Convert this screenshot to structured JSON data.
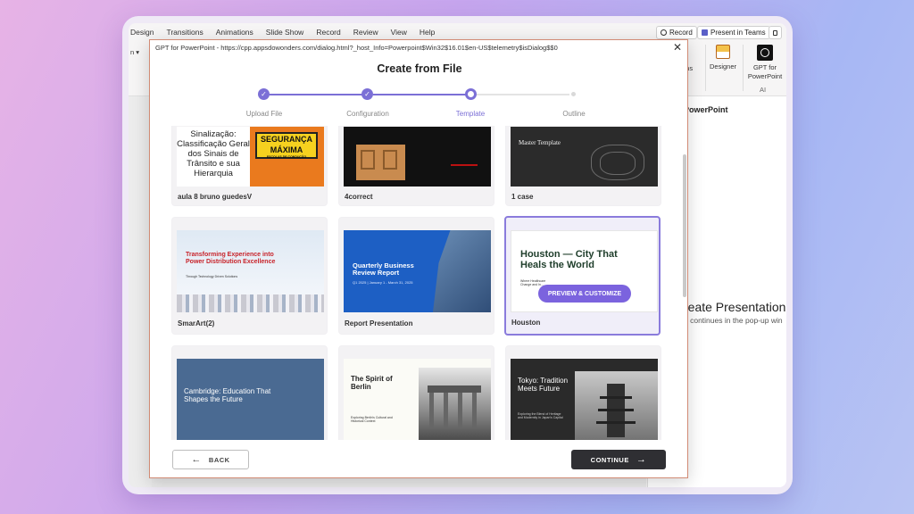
{
  "ribbon": {
    "menu": [
      "Design",
      "Transitions",
      "Animations",
      "Slide Show",
      "Record",
      "Review",
      "View",
      "Help"
    ],
    "record_label": "Record",
    "present_label": "Present in Teams",
    "addins_label": "-ins",
    "designer_label": "Designer",
    "gpt_label": "GPT for PowerPoint",
    "ai_group_label": "AI",
    "left_label": "n"
  },
  "side_pane": {
    "title": "PowerPoint",
    "heading": "reate Presentation",
    "subtext": "n continues in the pop-up win"
  },
  "dialog": {
    "url": "GPT for PowerPoint - https://cpp.appsdowonders.com/dialog.html?_host_Info=Powerpoint$Win32$16.01$en-US$telemetry$isDialog$$0",
    "title": "Create from File",
    "steps": [
      {
        "label": "Upload File",
        "state": "done"
      },
      {
        "label": "Configuration",
        "state": "done"
      },
      {
        "label": "Template",
        "state": "active"
      },
      {
        "label": "Outline",
        "state": "todo"
      }
    ],
    "back_label": "BACK",
    "continue_label": "CONTINUE"
  },
  "templates": [
    {
      "name": "aula 8 bruno guedesV",
      "thumb_text": "Sinalização: Classificação Geral dos Sinais de Trânsito e sua Hierarquia",
      "badge": "SEGURANÇA MÁXIMA",
      "badge_sub": "ESCOLAS DE CONDUÇÃO"
    },
    {
      "name": "4correct"
    },
    {
      "name": "1 case",
      "thumb_text": "Master Template"
    },
    {
      "name": "SmarArt(2)",
      "thumb_text": "Transforming Experience into Power Distribution Excellence",
      "thumb_sub": "Through Technology Driven Solutions"
    },
    {
      "name": "Report Presentation",
      "thumb_text": "Quarterly Business Review Report",
      "thumb_sub": "Q1 2025 | January 1 - March 31, 2025"
    },
    {
      "name": "Houston",
      "thumb_text": "Houston — City That Heals the World",
      "thumb_sub": "Where Healthcare Change and In...",
      "overlay_button": "PREVIEW & CUSTOMIZE",
      "selected": true
    },
    {
      "name": "",
      "thumb_text": "Cambridge: Education That Shapes the Future"
    },
    {
      "name": "",
      "thumb_text": "The Spirit of Berlin",
      "thumb_sub": "Exploring Berlin's Cultural and Historical Context"
    },
    {
      "name": "",
      "thumb_text": "Tokyo: Tradition Meets Future",
      "thumb_sub": "Exploring the Blend of Heritage and Modernity in Japan's Capital"
    }
  ]
}
